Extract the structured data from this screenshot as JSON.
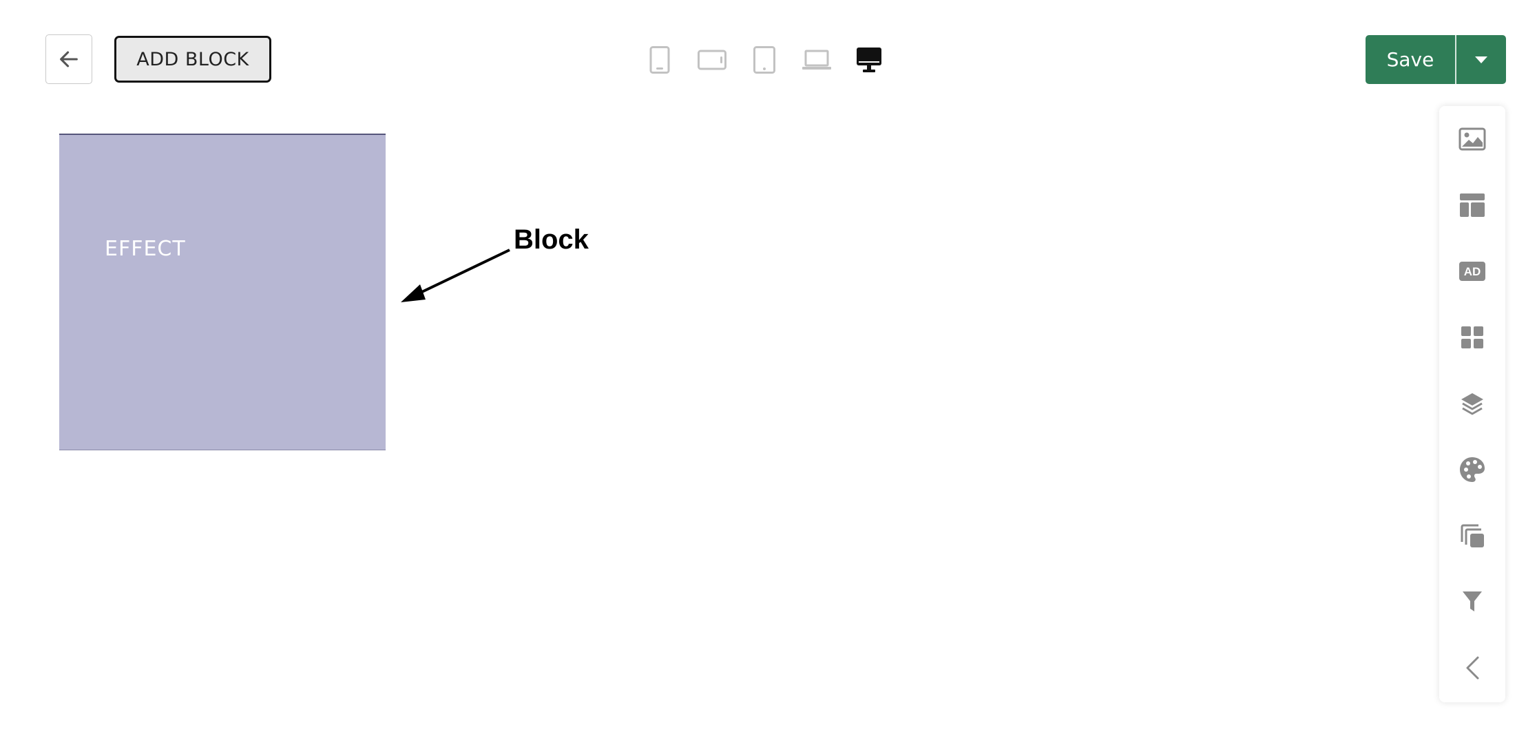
{
  "header": {
    "back_icon": "arrow-left-icon",
    "add_block_label": "ADD BLOCK",
    "devices": [
      {
        "name": "mobile-portrait",
        "icon": "phone-icon",
        "active": false
      },
      {
        "name": "mobile-landscape",
        "icon": "phone-landscape-icon",
        "active": false
      },
      {
        "name": "tablet",
        "icon": "tablet-icon",
        "active": false
      },
      {
        "name": "laptop",
        "icon": "laptop-icon",
        "active": false
      },
      {
        "name": "desktop",
        "icon": "desktop-icon",
        "active": true
      }
    ],
    "save_label": "Save",
    "save_menu_icon": "caret-down-icon"
  },
  "canvas": {
    "block_text": "EFFECT",
    "annotation_label": "Block"
  },
  "toolbar": {
    "tools": [
      {
        "name": "image",
        "icon": "image-icon"
      },
      {
        "name": "layout",
        "icon": "layout-icon"
      },
      {
        "name": "ad",
        "icon": "ad-icon",
        "text": "AD"
      },
      {
        "name": "widgets",
        "icon": "grid-icon"
      },
      {
        "name": "layers",
        "icon": "layers-icon"
      },
      {
        "name": "theme",
        "icon": "palette-icon"
      },
      {
        "name": "duplicate",
        "icon": "copy-icon"
      },
      {
        "name": "filter",
        "icon": "filter-icon"
      },
      {
        "name": "collapse",
        "icon": "chevron-left-icon"
      }
    ]
  },
  "colors": {
    "primary": "#2f7d57",
    "block_fill": "#b7b7d3",
    "icon_gray": "#8a8a8a",
    "device_inactive": "#c2c2c2",
    "device_active": "#111111"
  }
}
